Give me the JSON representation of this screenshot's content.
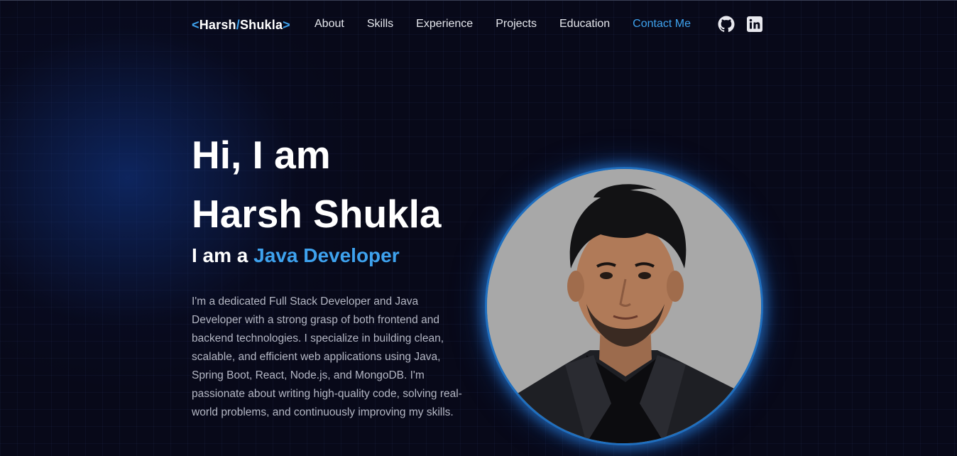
{
  "nav": {
    "logo": {
      "open": "<",
      "first": "Harsh",
      "slash": "/",
      "last": "Shukla",
      "close": ">"
    },
    "links": [
      "About",
      "Skills",
      "Experience",
      "Projects",
      "Education",
      "Contact Me"
    ],
    "active_link": "Contact Me",
    "social": [
      "github-icon",
      "linkedin-icon"
    ]
  },
  "hero": {
    "title_line1": "Hi, I am",
    "title_line2": "Harsh Shukla",
    "role_prefix": "I am a ",
    "role_highlight": "Java Developer",
    "bio": "I'm a dedicated Full Stack Developer and Java Developer with a strong grasp of both frontend and backend technologies. I specialize in building clean, scalable, and efficient web applications using Java, Spring Boot, React, Node.js, and MongoDB. I'm passionate about writing high-quality code, solving real-world problems, and continuously improving my skills."
  },
  "colors": {
    "accent": "#3ea2ee",
    "background": "#080919",
    "text": "#ffffff",
    "muted": "#b4b7c4"
  }
}
